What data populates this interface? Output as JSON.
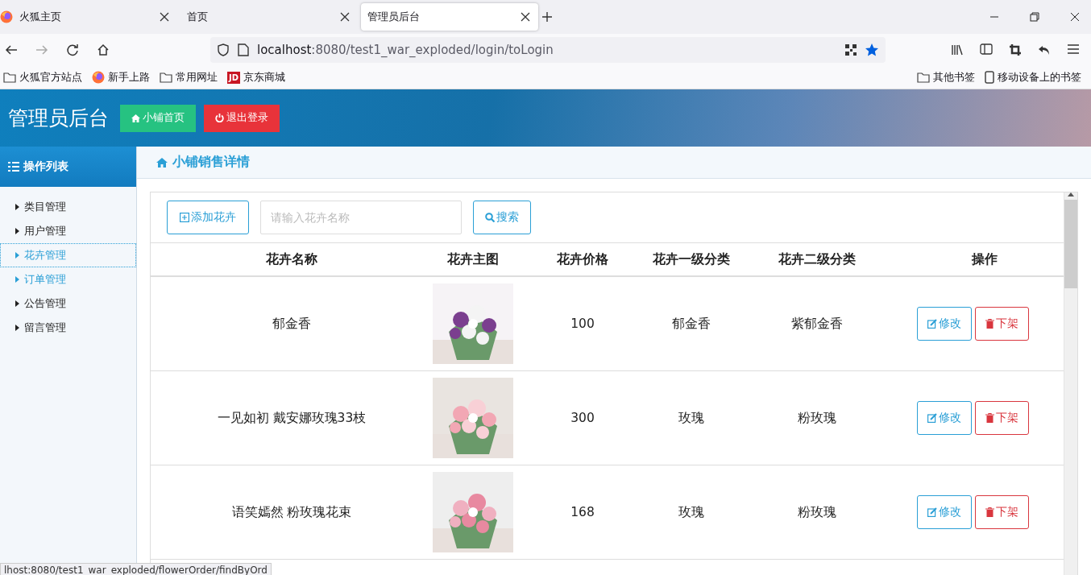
{
  "browser": {
    "tabs": [
      {
        "label": "火狐主页",
        "selected": false,
        "kind": "firefox"
      },
      {
        "label": "首页",
        "selected": false,
        "kind": "plain"
      },
      {
        "label": "管理员后台",
        "selected": true,
        "kind": "plain"
      }
    ],
    "url": {
      "host": "localhost",
      "rest": ":8080/test1_war_exploded/login/toLogin"
    },
    "bookmarks": [
      {
        "label": "火狐官方站点",
        "kind": "folder"
      },
      {
        "label": "新手上路",
        "kind": "firefox"
      },
      {
        "label": "常用网址",
        "kind": "folder"
      },
      {
        "label": "京东商城",
        "kind": "jd",
        "badge": "JD"
      }
    ],
    "bookmarks_right": [
      {
        "label": "其他书签",
        "kind": "folder"
      },
      {
        "label": "移动设备上的书签",
        "kind": "phone"
      }
    ]
  },
  "header": {
    "title": "管理员后台",
    "buttons": [
      {
        "label": "小铺首页",
        "kind": "home"
      },
      {
        "label": "退出登录",
        "kind": "logout"
      }
    ]
  },
  "sidebar": {
    "title": "操作列表",
    "items": [
      {
        "label": "类目管理",
        "selected": false,
        "hovered": false
      },
      {
        "label": "用户管理",
        "selected": false,
        "hovered": false
      },
      {
        "label": "花卉管理",
        "selected": true,
        "hovered": false
      },
      {
        "label": "订单管理",
        "selected": false,
        "hovered": true
      },
      {
        "label": "公告管理",
        "selected": false,
        "hovered": false
      },
      {
        "label": "留言管理",
        "selected": false,
        "hovered": false
      }
    ]
  },
  "content": {
    "title": "小铺销售详情",
    "add_button": "添加花卉",
    "search": {
      "placeholder": "请输入花卉名称"
    },
    "search_button": "搜索",
    "table": {
      "columns": [
        "花卉名称",
        "花卉主图",
        "花卉价格",
        "花卉一级分类",
        "花卉二级分类",
        "操作"
      ],
      "rows": [
        {
          "name": "郁金香",
          "price": "100",
          "category_1": "郁金香",
          "category_2": "紫郁金香",
          "edit": "修改",
          "remove": "下架"
        },
        {
          "name": "一见如初 戴安娜玫瑰33枝",
          "price": "300",
          "category_1": "玫瑰",
          "category_2": "粉玫瑰",
          "edit": "修改",
          "remove": "下架"
        },
        {
          "name": "语笑嫣然 粉玫瑰花束",
          "price": "168",
          "category_1": "玫瑰",
          "category_2": "粉玫瑰",
          "edit": "修改",
          "remove": "下架"
        }
      ]
    }
  },
  "status_bar": "lhost:8080/test1_war_exploded/flowerOrder/findByOrd"
}
